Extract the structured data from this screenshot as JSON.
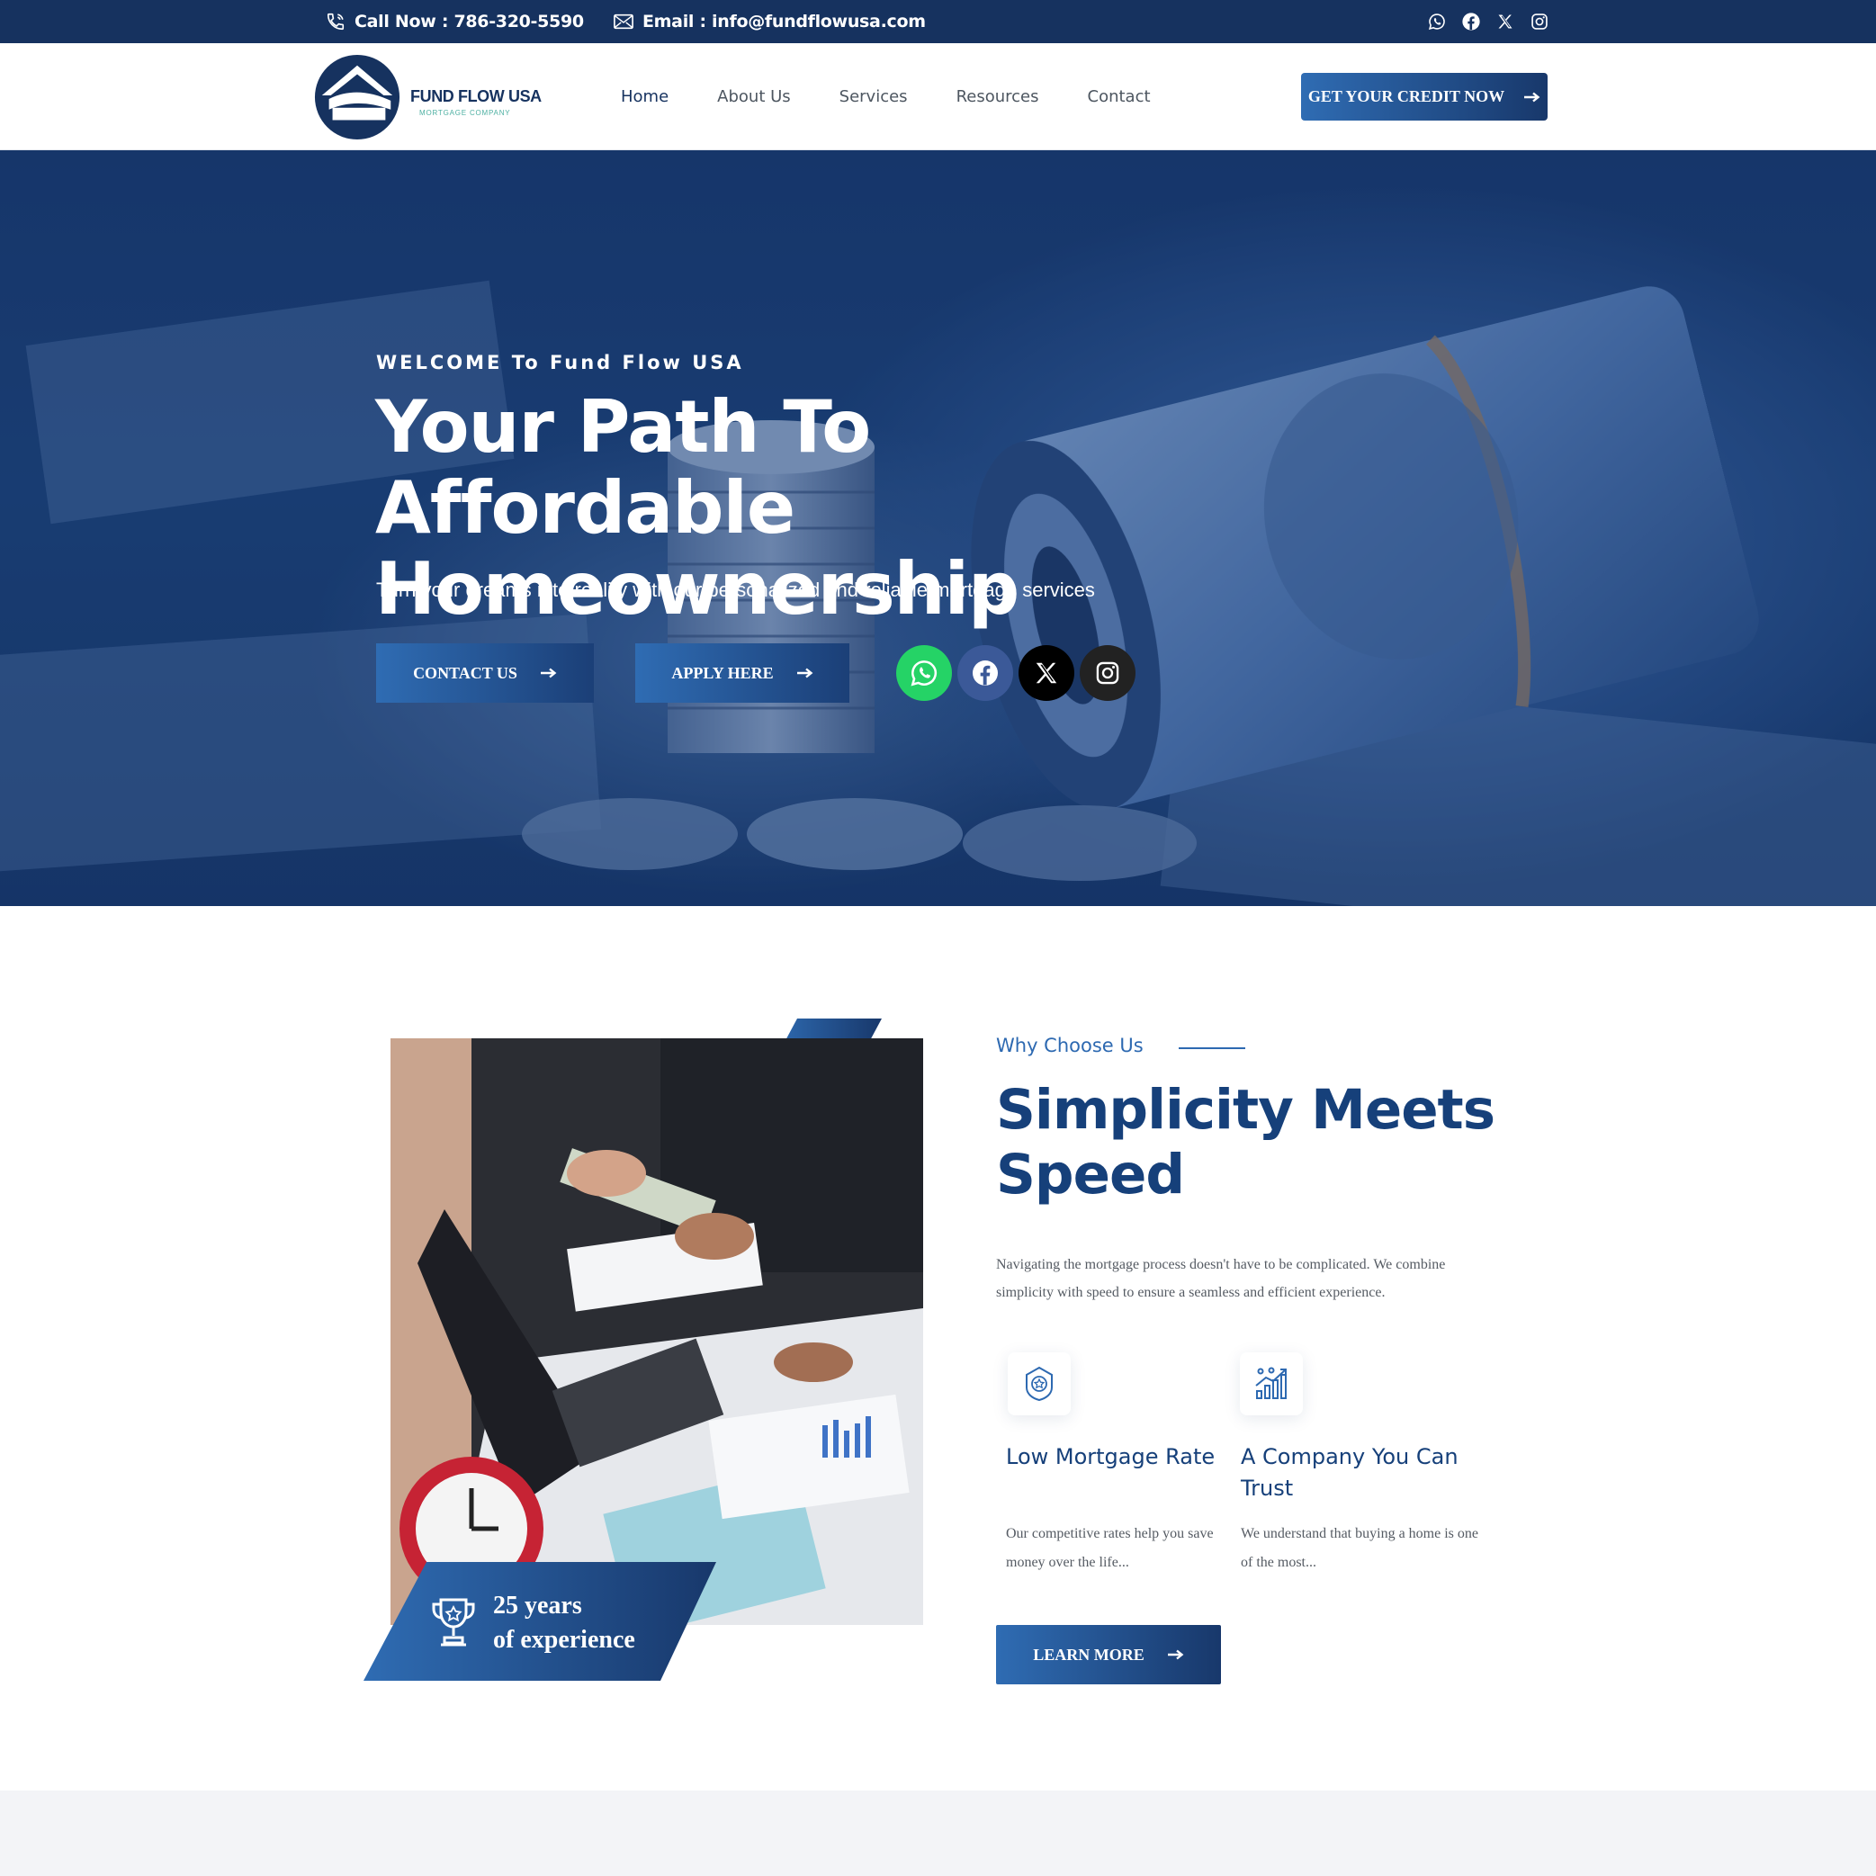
{
  "topbar": {
    "phone": "Call Now : 786-320-5590",
    "email": "Email : info@fundflowusa.com",
    "socials": [
      "whatsapp-icon",
      "facebook-icon",
      "x-icon",
      "instagram-icon"
    ]
  },
  "header": {
    "logo_title": "FUND FLOW USA",
    "logo_subtitle": "MORTGAGE COMPANY",
    "nav": [
      "Home",
      "About Us",
      "Services",
      "Resources",
      "Contact"
    ],
    "active_nav": "Home",
    "cta_label": "GET YOUR CREDIT NOW"
  },
  "hero": {
    "eyebrow": "WELCOME To Fund Flow USA",
    "title_line1": "Your Path To Affordable",
    "title_line2": "Homeownership",
    "subtitle": "Turn your dreams into reality with our personalized and reliable mortgage services",
    "contact_label": "CONTACT US",
    "apply_label": "APPLY HERE",
    "socials": [
      "whatsapp-icon",
      "facebook-icon",
      "x-icon",
      "instagram-icon"
    ]
  },
  "why": {
    "label": "Why Choose Us",
    "title_line1": "Simplicity Meets",
    "title_line2": "Speed",
    "description": "Navigating the mortgage process doesn't have to be complicated. We combine simplicity with speed to ensure a seamless and efficient experience.",
    "badge_line1": "25 years",
    "badge_line2": "of experience",
    "features": [
      {
        "icon": "award-badge-icon",
        "title": "Low Mortgage Rate",
        "description": "Our competitive rates help you save money over the life..."
      },
      {
        "icon": "growth-chart-icon",
        "title": "A Company You Can Trust",
        "description": "We understand that buying a home is one of the most..."
      }
    ],
    "learn_more_label": "LEARN MORE"
  },
  "colors": {
    "primary_dark": "#16325f",
    "accent_blue": "#2f6cb3",
    "heading_blue": "#16407a",
    "whatsapp": "#25d366",
    "facebook": "#3b5998",
    "x": "#000000",
    "instagram": "#222222"
  }
}
